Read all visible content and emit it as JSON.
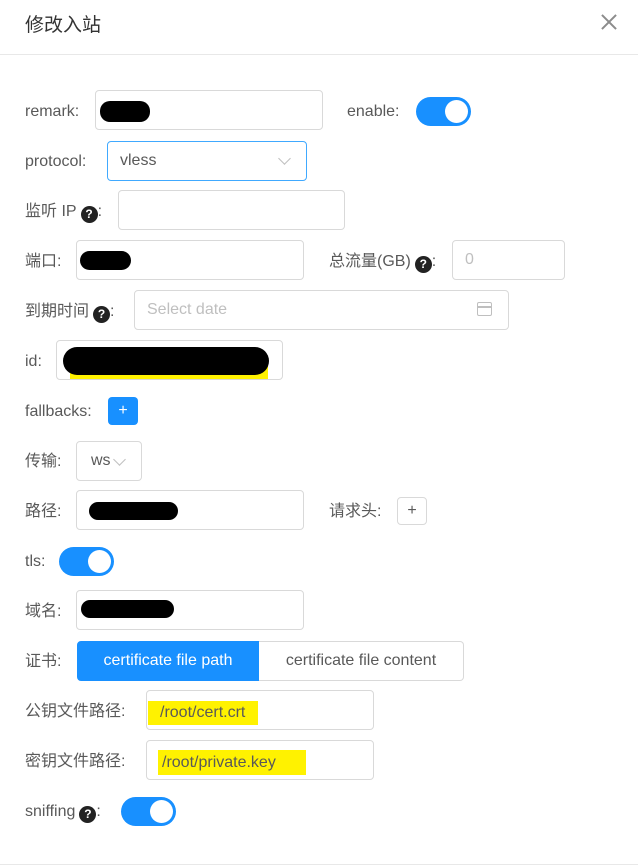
{
  "dialog": {
    "title": "修改入站"
  },
  "form": {
    "remark_label": "remark:",
    "enable_label": "enable:",
    "enable_on": true,
    "protocol_label": "protocol:",
    "protocol_value": "vless",
    "listen_ip_label": "监听 IP",
    "port_label": "端口:",
    "total_traffic_label": "总流量(GB)",
    "total_traffic_value": "0",
    "expiry_label": "到期时间",
    "expiry_placeholder": "Select date",
    "id_label": "id:",
    "fallbacks_label": "fallbacks:",
    "transport_label": "传输:",
    "transport_value": "ws",
    "path_label": "路径:",
    "request_header_label": "请求头:",
    "tls_label": "tls:",
    "tls_on": true,
    "domain_label": "域名:",
    "cert_label": "证书:",
    "cert_tabs": [
      "certificate file path",
      "certificate file content"
    ],
    "public_key_path_label": "公钥文件路径:",
    "public_key_path_value": "/root/cert.crt",
    "private_key_path_label": "密钥文件路径:",
    "private_key_path_value": "/root/private.key",
    "sniffing_label": "sniffing",
    "sniffing_on": true,
    "colon": ":",
    "help_glyph": "?",
    "plus_glyph": "+"
  },
  "colors": {
    "accent": "#1890ff",
    "highlight": "#fff200",
    "redaction": "#000000"
  },
  "icons": [
    "close-icon",
    "question-circle-icon",
    "chevron-down-icon",
    "calendar-icon",
    "plus-icon"
  ]
}
